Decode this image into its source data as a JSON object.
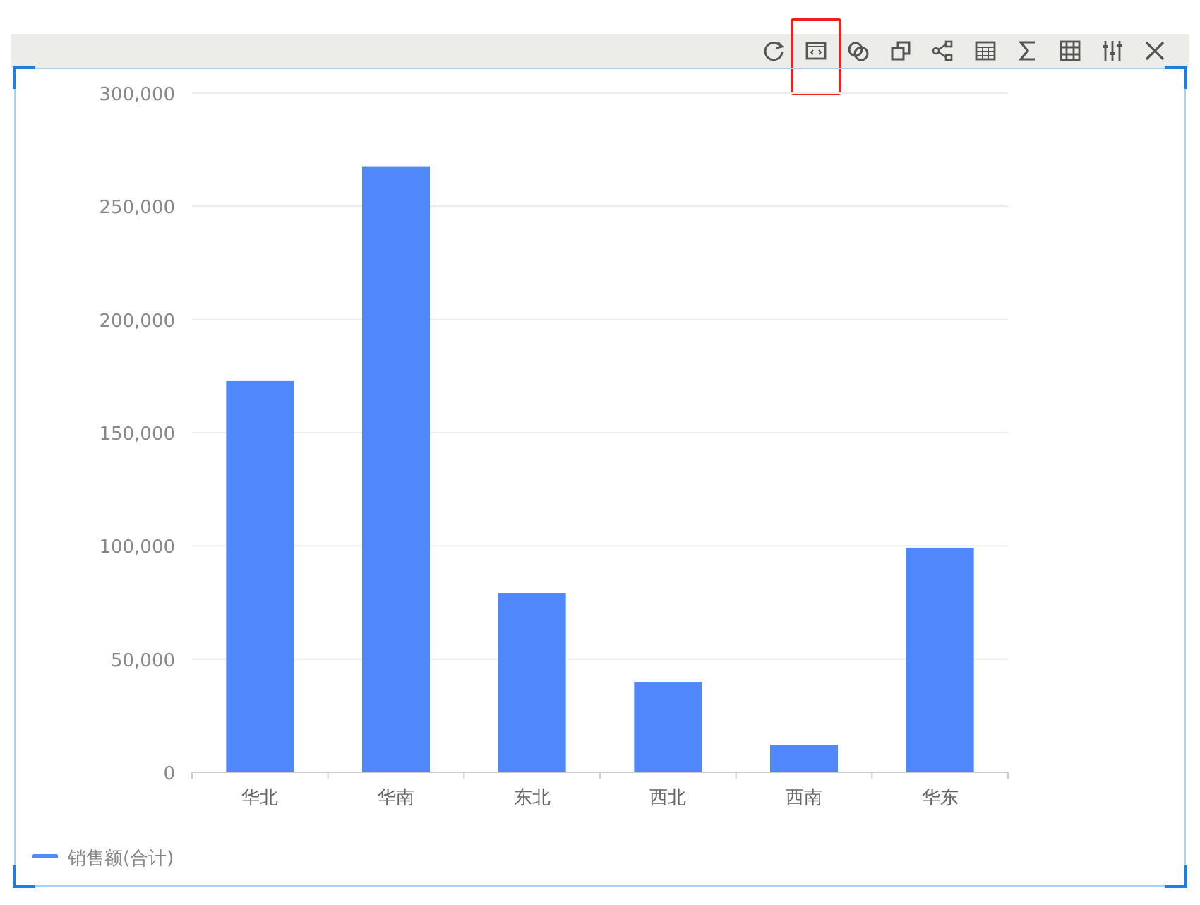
{
  "toolbar": {
    "tools": [
      {
        "kind": "refresh",
        "selected": false
      },
      {
        "kind": "code",
        "selected": true
      },
      {
        "kind": "circles",
        "selected": false
      },
      {
        "kind": "copy",
        "selected": false
      },
      {
        "kind": "share",
        "selected": false
      },
      {
        "kind": "table",
        "selected": false
      },
      {
        "kind": "sum",
        "selected": false
      },
      {
        "kind": "grid",
        "selected": false
      },
      {
        "kind": "sliders",
        "selected": false
      },
      {
        "kind": "close",
        "selected": false
      }
    ]
  },
  "chart": {
    "chart_data": {
      "type": "bar",
      "categories": [
        "华北",
        "华南",
        "东北",
        "西北",
        "西南",
        "华东"
      ],
      "series": [
        {
          "name": "销售额(合计)",
          "color": "#5088fc",
          "values": [
            172800,
            267700,
            79200,
            39900,
            11900,
            99200
          ]
        }
      ],
      "ylim": [
        0,
        300000
      ],
      "grid": true,
      "yticks": [
        {
          "value": 0,
          "label": "0"
        },
        {
          "value": 50000,
          "label": "50,000"
        },
        {
          "value": 100000,
          "label": "100,000"
        },
        {
          "value": 150000,
          "label": "150,000"
        },
        {
          "value": 200000,
          "label": "200,000"
        },
        {
          "value": 250000,
          "label": "250,000"
        },
        {
          "value": 300000,
          "label": "300,000"
        }
      ]
    }
  }
}
